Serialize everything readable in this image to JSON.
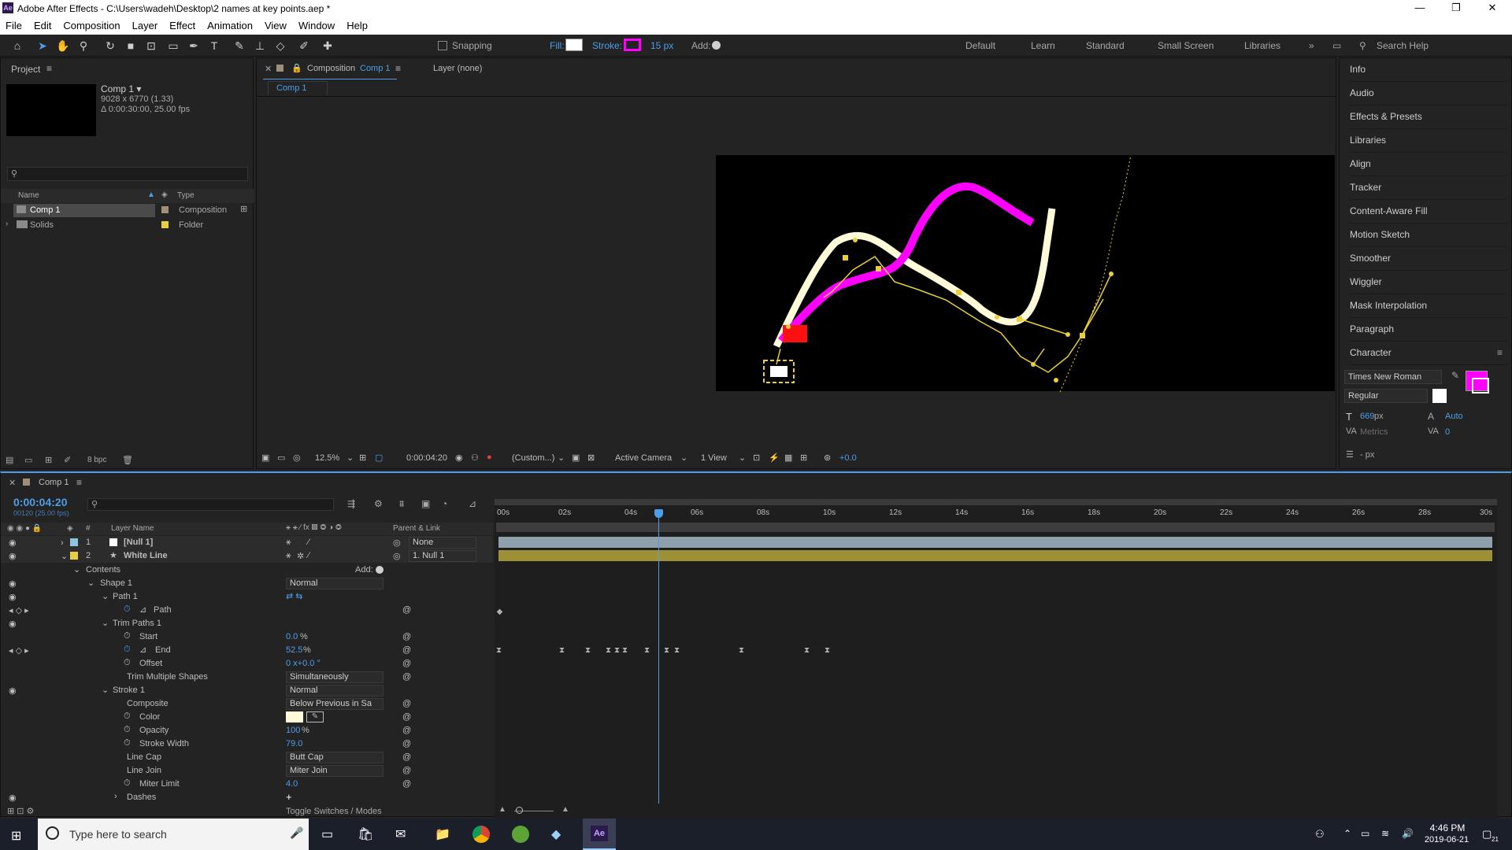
{
  "window": {
    "title": "Adobe After Effects - C:\\Users\\wadeh\\Desktop\\2 names at key points.aep *",
    "logo": "Ae"
  },
  "menu": [
    "File",
    "Edit",
    "Composition",
    "Layer",
    "Effect",
    "Animation",
    "View",
    "Window",
    "Help"
  ],
  "toolbar": {
    "snapping": "Snapping",
    "fill": "Fill:",
    "stroke": "Stroke:",
    "stroke_px": "15 px",
    "add": "Add:",
    "workspaces": [
      "Default",
      "Learn",
      "Standard",
      "Small Screen",
      "Libraries"
    ],
    "search": "Search Help"
  },
  "project": {
    "title": "Project",
    "comp_name": "Comp 1 ▾",
    "comp_size": "9028 x 6770 (1.33)",
    "comp_duration": "Δ 0:00:30:00, 25.00 fps",
    "col_name": "Name",
    "col_type": "Type",
    "items": [
      {
        "name": "Comp 1",
        "type": "Composition"
      },
      {
        "name": "Solids",
        "type": "Folder"
      }
    ],
    "bpc": "8 bpc"
  },
  "composition": {
    "tab": "Composition",
    "tab_name": "Comp 1",
    "layer_tab": "Layer (none)",
    "subtab": "Comp 1",
    "zoom": "12.5%",
    "timecode": "0:00:04:20",
    "resolution": "(Custom...)",
    "camera": "Active Camera",
    "views": "1 View",
    "exposure": "+0.0"
  },
  "right_panels": [
    "Info",
    "Audio",
    "Effects & Presets",
    "Libraries",
    "Align",
    "Tracker",
    "Content-Aware Fill",
    "Motion Sketch",
    "Smoother",
    "Wiggler",
    "Mask Interpolation",
    "Paragraph",
    "Character"
  ],
  "character": {
    "font": "Times New Roman",
    "style": "Regular",
    "size": "669",
    "size_unit": "px",
    "leading": "Auto",
    "kerning": "Metrics",
    "tracking": "0",
    "unit": "- px"
  },
  "timeline": {
    "tab": "Comp 1",
    "timecode": "0:00:04:20",
    "frames": "00120 (25.00 fps)",
    "col_layer": "Layer Name",
    "col_parent": "Parent & Link",
    "layers": [
      {
        "num": "1",
        "name": "[Null 1]",
        "parent": "None"
      },
      {
        "num": "2",
        "name": "White Line",
        "parent": "1. Null 1"
      }
    ],
    "ruler": [
      "00s",
      "02s",
      "04s",
      "06s",
      "08s",
      "10s",
      "12s",
      "14s",
      "16s",
      "18s",
      "20s",
      "22s",
      "24s",
      "26s",
      "28s",
      "30s"
    ],
    "props": {
      "contents": "Contents",
      "add": "Add:",
      "shape1": "Shape 1",
      "blend": "Normal",
      "path1": "Path 1",
      "path": "Path",
      "trim": "Trim Paths 1",
      "start": "Start",
      "start_v": "0.0",
      "start_u": "%",
      "end": "End",
      "end_v": "52.5",
      "end_u": "%",
      "offset": "Offset",
      "offset_v": "0 x+0.0 °",
      "tms": "Trim Multiple Shapes",
      "tms_v": "Simultaneously",
      "stroke1": "Stroke 1",
      "stroke_blend": "Normal",
      "composite": "Composite",
      "composite_v": "Below Previous in Sa",
      "color": "Color",
      "opacity": "Opacity",
      "opacity_v": "100",
      "opacity_u": "%",
      "sw": "Stroke Width",
      "sw_v": "79.0",
      "cap": "Line Cap",
      "cap_v": "Butt Cap",
      "join": "Line Join",
      "join_v": "Miter Join",
      "miter": "Miter Limit",
      "miter_v": "4.0",
      "dashes": "Dashes"
    },
    "toggle": "Toggle Switches / Modes"
  },
  "taskbar": {
    "search": "Type here to search",
    "time": "4:46 PM",
    "date": "2019-06-21",
    "notif": "21"
  },
  "colors": {
    "accent": "#4d9ee8",
    "magenta": "#ff00ff",
    "yellow": "#e8cf3b",
    "bg": "#232323"
  }
}
